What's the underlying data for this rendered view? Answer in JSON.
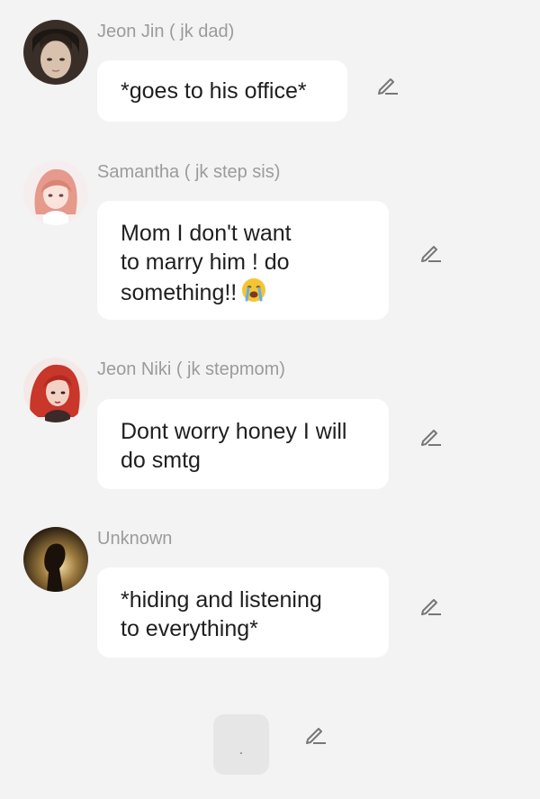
{
  "messages": [
    {
      "name": "Jeon Jin ( jk dad)",
      "lines": [
        "*goes to his office*"
      ],
      "avatar": "dark-haired-man-avatar"
    },
    {
      "name": "Samantha ( jk step sis)",
      "lines": [
        "Mom I don't want",
        "to marry him ! do",
        "something!!"
      ],
      "emoji": "loudly-crying-face-icon",
      "avatar": "pink-haired-girl-avatar"
    },
    {
      "name": "Jeon Niki ( jk stepmom)",
      "lines": [
        "Dont worry honey I will",
        "do smtg"
      ],
      "avatar": "red-haired-woman-avatar"
    },
    {
      "name": "Unknown",
      "lines": [
        "*hiding and listening",
        "to everything*"
      ],
      "avatar": "silhouette-avatar"
    }
  ],
  "composer": {
    "placeholder": "."
  },
  "icons": {
    "edit": "pencil-edit-icon"
  },
  "colors": {
    "background": "#f3f3f3",
    "bubble": "#ffffff",
    "name": "#9b9b9b",
    "text": "#1f1f1f"
  }
}
